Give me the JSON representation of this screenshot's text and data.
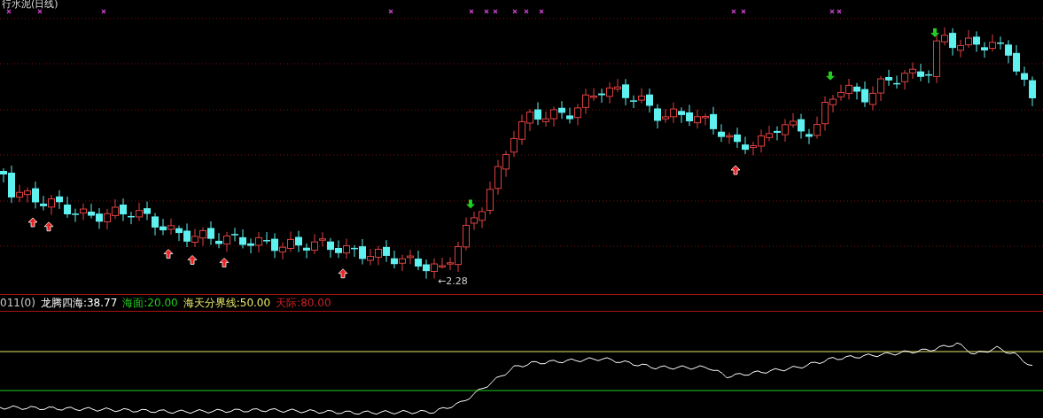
{
  "chart": {
    "title": "行水泥(日线)",
    "low_label": "←2.28"
  },
  "indicator": {
    "name": "011(0)",
    "lines": [
      {
        "label": "龙腾四海:38.77",
        "color": "#ffffff"
      },
      {
        "label": "海面:20.00",
        "color": "#22cc22"
      },
      {
        "label": "海天分界线:50.00",
        "color": "#e8e86a"
      },
      {
        "label": "天际:80.00",
        "color": "#cc2222"
      }
    ]
  }
}
